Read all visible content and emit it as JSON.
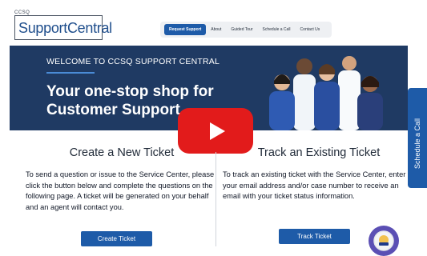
{
  "header": {
    "logo_small": "CCSQ",
    "logo_text": "SupportCentral",
    "nav": [
      {
        "label": "Request Support",
        "active": true
      },
      {
        "label": "About"
      },
      {
        "label": "Guided Tour"
      },
      {
        "label": "Schedule a Call"
      },
      {
        "label": "Contact Us"
      }
    ]
  },
  "banner": {
    "welcome": "WELCOME TO CCSQ SUPPORT CENTRAL",
    "title": "Your one-stop shop for Customer Support"
  },
  "video": {
    "play_icon": "play-icon"
  },
  "side_tab": {
    "label": "Schedule a Call",
    "icon": "phone-icon"
  },
  "create": {
    "title": "Create a New Ticket",
    "body": "To send a question or issue to the Service Center, please click the button below and complete the questions on the following page. A ticket will be generated on your behalf and an agent will contact you.",
    "button": "Create Ticket"
  },
  "track": {
    "title": "Track an Existing Ticket",
    "body": "To track an existing ticket with the Service Center, enter your email address and/or case number to receive an email with your ticket status information.",
    "button": "Track Ticket"
  },
  "colors": {
    "brand_blue": "#1e5ba8",
    "banner_bg": "#1f3a63",
    "play_red": "#e21b1b"
  }
}
